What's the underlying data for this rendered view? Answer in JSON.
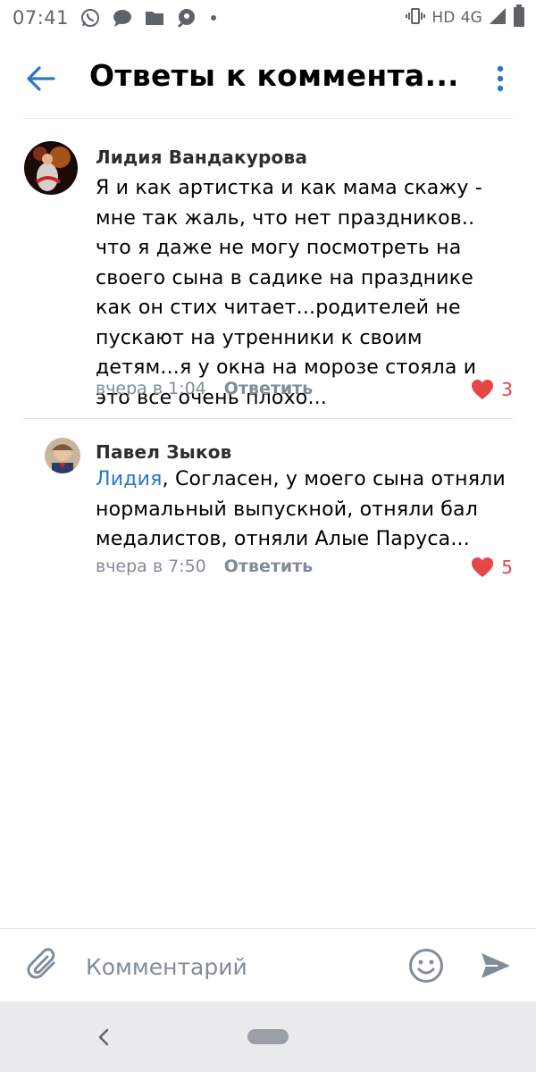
{
  "status_bar": {
    "time": "07:41",
    "network": "HD",
    "signal": "4G",
    "icons": [
      "whatsapp-icon",
      "message-icon",
      "folder-icon",
      "podcast-icon",
      "dot-icon",
      "vibrate-icon",
      "signal-icon",
      "battery-icon"
    ]
  },
  "header": {
    "title": "Ответы к коммента...",
    "back_icon": "arrow-left-icon",
    "menu_icon": "more-vertical-icon"
  },
  "comments": [
    {
      "author": "Лидия Вандакурова",
      "text": "Я и как артистка и как мама скажу - мне так жаль, что нет праздников.. что я даже не могу посмотреть на своего сына в садике на празднике как он стих читает...родителей не пускают на утренники к своим детям...я у окна на морозе стояла и это все очень плохо...",
      "time": "вчера в 1:04",
      "reply_label": "Ответить",
      "likes": "3"
    },
    {
      "author": "Павел Зыков",
      "mention": "Лидия",
      "text": ", Согласен, у моего сына отняли нормальный выпускной, отняли бал медалистов, отняли Алые Паруса...",
      "time": "вчера в 7:50",
      "reply_label": "Ответить",
      "likes": "5"
    }
  ],
  "composer": {
    "placeholder": "Комментарий",
    "attach_icon": "paperclip-icon",
    "emoji_icon": "smile-icon",
    "send_icon": "send-icon"
  },
  "colors": {
    "accent": "#2a78c5",
    "like": "#e64646",
    "secondary_text": "#818c99",
    "divider": "#e3e4e8",
    "navbar": "#e9eaec"
  }
}
